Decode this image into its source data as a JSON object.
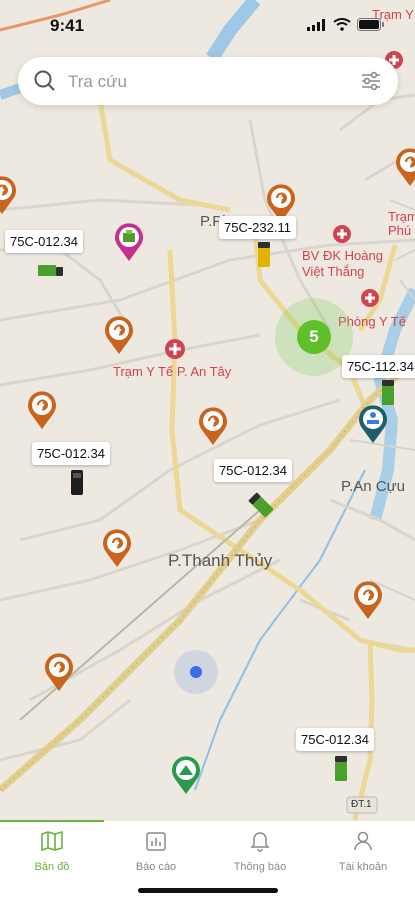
{
  "status_bar": {
    "time": "9:41"
  },
  "search": {
    "placeholder": "Tra cứu"
  },
  "map": {
    "cluster_count": "5",
    "places": {
      "tram_y_te_an_tay": "Trạm Y Tế P. An Tây",
      "bv_dk_hoang_viet_thang": "BV ĐK Hoàng Việt Thắng",
      "phong_y_te": "Phòng Y Tế",
      "p_thanh_thuy": "P.Thanh Thủy",
      "p_an_cuu": "P.An Cựu",
      "p_phu": "P.Ph",
      "tram_top": "Trạm Y Tế P. Long",
      "tram_phu": "Trạm Phú",
      "road_badge": "ĐT.1"
    },
    "vehicles": [
      {
        "plate": "75C-012.34"
      },
      {
        "plate": "75C-232.11"
      },
      {
        "plate": "75C-112.34"
      },
      {
        "plate": "75C-012.34"
      },
      {
        "plate": "75C-012.34"
      },
      {
        "plate": "75C-012.34"
      }
    ]
  },
  "tabbar": {
    "items": [
      {
        "label": "Bản đồ",
        "icon": "map-icon",
        "active": true
      },
      {
        "label": "Báo cáo",
        "icon": "report-icon",
        "active": false
      },
      {
        "label": "Thông báo",
        "icon": "bell-icon",
        "active": false
      },
      {
        "label": "Tài khoản",
        "icon": "user-icon",
        "active": false
      }
    ]
  },
  "colors": {
    "accent": "#6bb23f",
    "pin": "#d2691e",
    "health": "#d2434f",
    "map_bg": "#ede9e0"
  }
}
